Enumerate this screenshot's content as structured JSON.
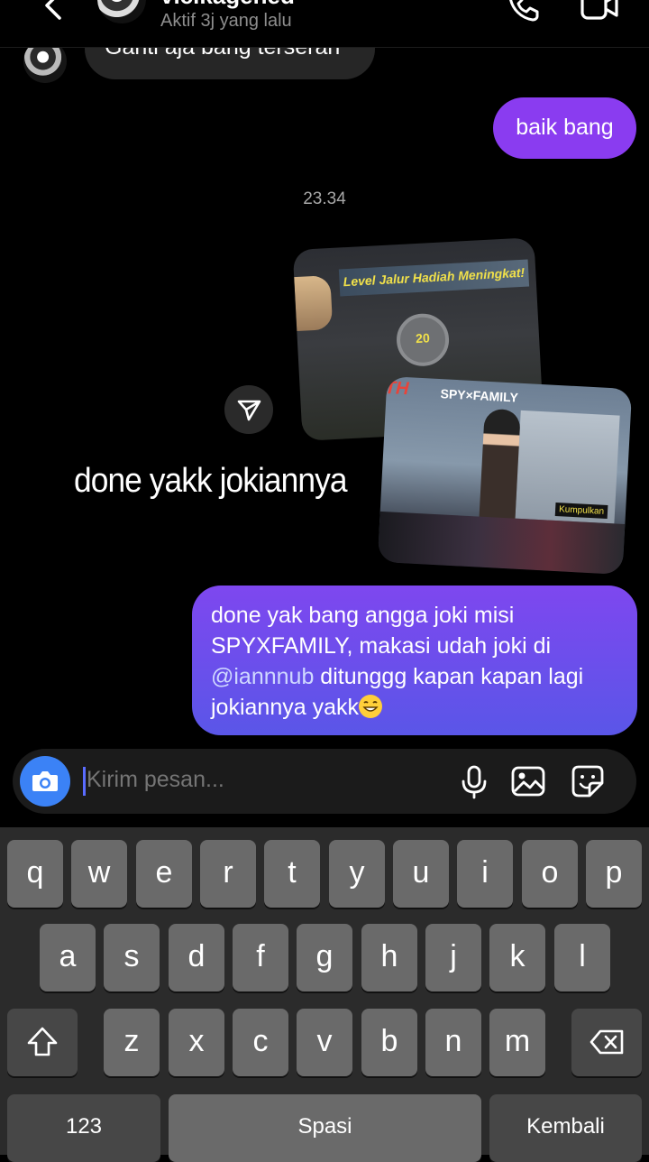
{
  "header": {
    "contact_name": "vicikagened",
    "status": "Aktif 3j yang lalu"
  },
  "messages": {
    "incoming_partial": "Ganti aja bang terserah",
    "outgoing_1": "baik bang",
    "timestamp": "23.34",
    "story_card_1": {
      "banner": "Level Jalur Hadiah Meningkat!",
      "level": "20"
    },
    "story_card_2": {
      "brand": "SPY×FAMILY",
      "logo": "TH",
      "label": "Kumpulkan"
    },
    "story_caption": "done yakk jokiannya",
    "outgoing_2_parts": {
      "before_mention": "done yak bang angga joki misi SPYXFAMILY, makasi udah joki di ",
      "mention": "@iannnub",
      "after_mention": " ditunggg kapan kapan lagi jokiannya yakk"
    }
  },
  "composer": {
    "placeholder": "Kirim pesan..."
  },
  "keyboard": {
    "row1": [
      "q",
      "w",
      "e",
      "r",
      "t",
      "y",
      "u",
      "i",
      "o",
      "p"
    ],
    "row2": [
      "a",
      "s",
      "d",
      "f",
      "g",
      "h",
      "j",
      "k",
      "l"
    ],
    "row3": [
      "z",
      "x",
      "c",
      "v",
      "b",
      "n",
      "m"
    ],
    "numbers_label": "123",
    "space_label": "Spasi",
    "return_label": "Kembali"
  },
  "colors": {
    "outgoing_bubble": "#8a3cf0",
    "outgoing_bubble_gradient_end": "#5a56e8",
    "incoming_bubble": "#262626",
    "camera_button": "#3b82f6"
  }
}
